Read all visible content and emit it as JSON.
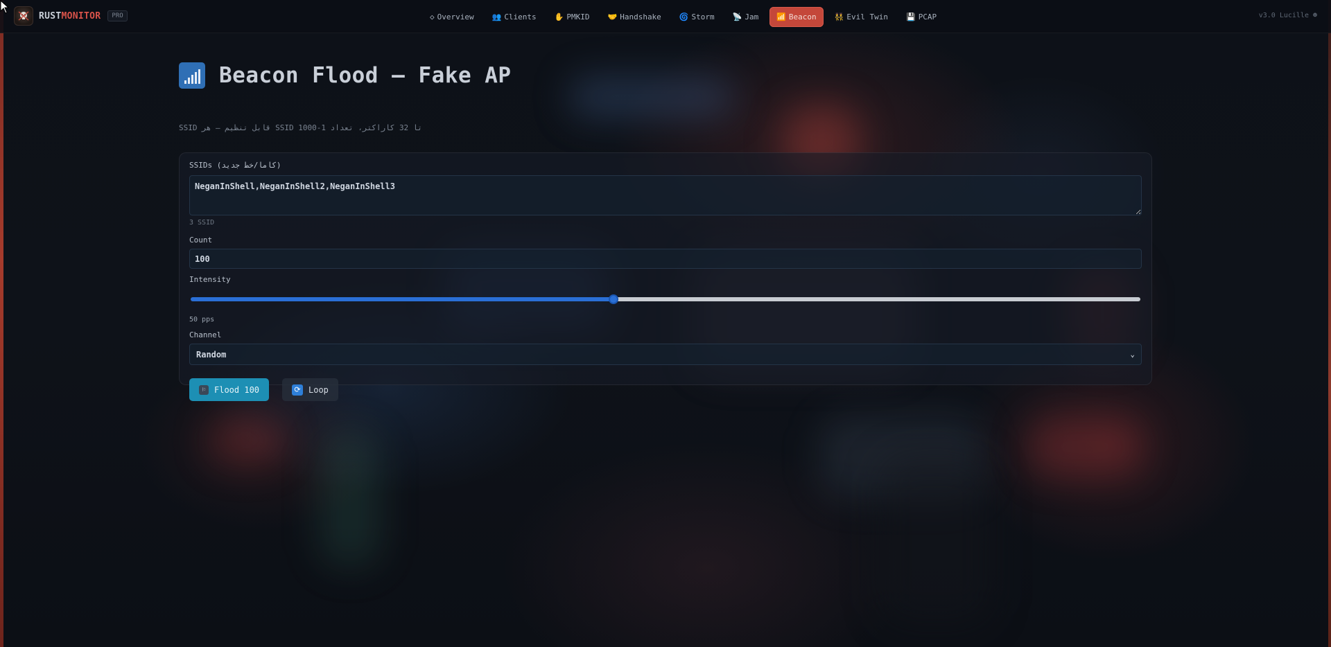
{
  "brand": {
    "name_a": "RUST",
    "name_b": "MONITOR",
    "badge": "PRO"
  },
  "nav": {
    "items": [
      {
        "icon": "◇",
        "label": "Overview"
      },
      {
        "icon": "👥",
        "label": "Clients"
      },
      {
        "icon": "✋",
        "label": "PMKID"
      },
      {
        "icon": "🤝",
        "label": "Handshake"
      },
      {
        "icon": "🌀",
        "label": "Storm"
      },
      {
        "icon": "📡",
        "label": "Jam"
      },
      {
        "icon": "📶",
        "label": "Beacon"
      },
      {
        "icon": "👯",
        "label": "Evil Twin"
      },
      {
        "icon": "💾",
        "label": "PCAP"
      }
    ],
    "active": "Beacon"
  },
  "version": {
    "text": "v3.0 Lucille",
    "icon": "☻"
  },
  "page": {
    "title": "Beacon Flood — Fake AP",
    "subtitle": "تا 32 کاراکتر، تعداد 1-1000 SSID قابل تنظیم — هر SSID"
  },
  "form": {
    "ssids_label": "SSIDs (کاما/خط جدید)",
    "ssids_value": "NeganInShell,NeganInShell2,NeganInShell3",
    "ssid_count": "3 SSID",
    "count_label": "Count",
    "count_value": "100",
    "intensity_label": "Intensity",
    "intensity_value_text": "50 pps",
    "intensity_fraction": 0.445,
    "channel_label": "Channel",
    "channel_value": "Random",
    "flood_button": "Flood 100",
    "loop_button": "Loop"
  },
  "colors": {
    "accent": "#c4473a",
    "primary_button": "#1d8fb4",
    "slider_fill": "#2a6fd6"
  }
}
